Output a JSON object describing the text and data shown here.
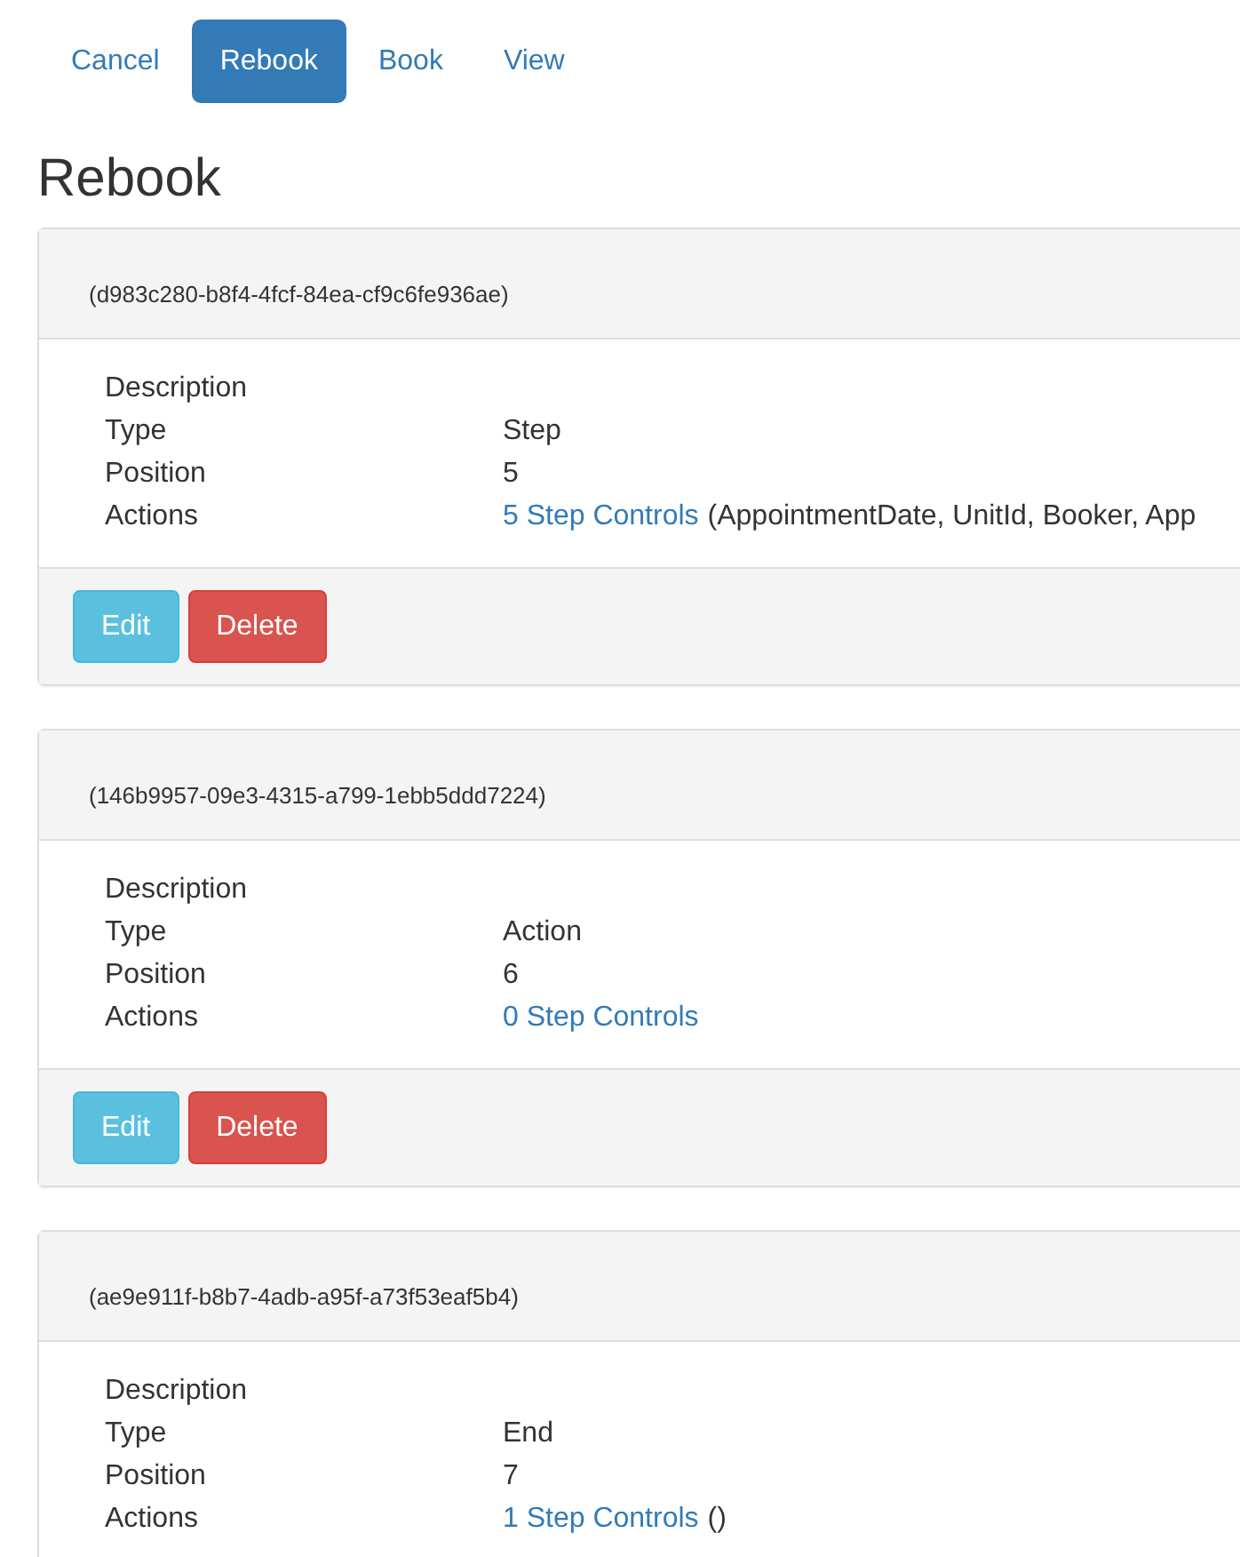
{
  "nav": [
    {
      "label": "Cancel",
      "selected": false
    },
    {
      "label": "Rebook",
      "selected": true
    },
    {
      "label": "Book",
      "selected": false
    },
    {
      "label": "View",
      "selected": false
    }
  ],
  "heading": "Rebook",
  "panels": [
    {
      "id": "(d983c280-b8f4-4fcf-84ea-cf9c6fe936ae)",
      "details": [
        {
          "label": "Description"
        },
        {
          "label": "Type",
          "value": "Step"
        },
        {
          "label": "Position",
          "value": "5"
        },
        {
          "label": "Actions",
          "link": "5 Step Controls",
          "value": "(AppointmentDate, UnitId, Booker, App"
        }
      ],
      "buttons": [
        {
          "label": "Edit",
          "kind": "info"
        },
        {
          "label": "Delete",
          "kind": "danger"
        }
      ]
    },
    {
      "id": "(146b9957-09e3-4315-a799-1ebb5ddd7224)",
      "details": [
        {
          "label": "Description"
        },
        {
          "label": "Type",
          "value": "Action"
        },
        {
          "label": "Position",
          "value": "6"
        },
        {
          "label": "Actions",
          "link": "0 Step Controls"
        }
      ],
      "buttons": [
        {
          "label": "Edit",
          "kind": "info"
        },
        {
          "label": "Delete",
          "kind": "danger"
        }
      ]
    },
    {
      "id": "(ae9e911f-b8b7-4adb-a95f-a73f53eaf5b4)",
      "details": [
        {
          "label": "Description"
        },
        {
          "label": "Type",
          "value": "End"
        },
        {
          "label": "Position",
          "value": "7"
        },
        {
          "label": "Actions",
          "link": "1 Step Controls",
          "value": "()"
        }
      ]
    }
  ]
}
